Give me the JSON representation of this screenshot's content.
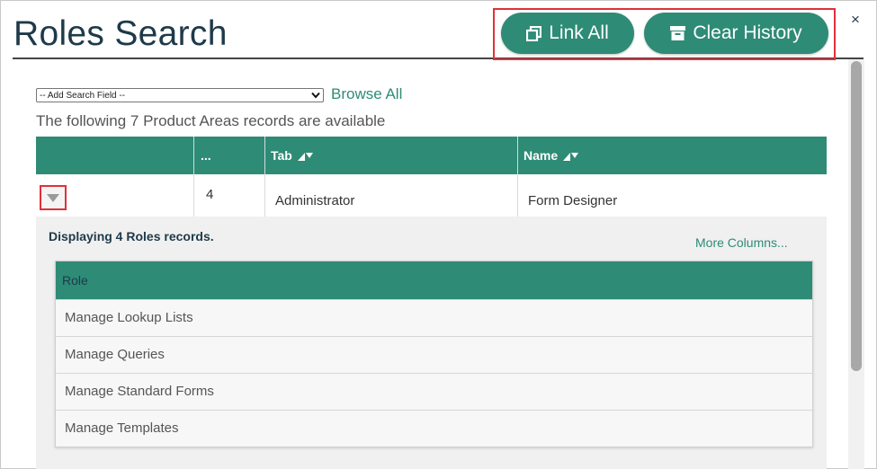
{
  "header": {
    "title": "Roles Search",
    "close_symbol": "×"
  },
  "toolbar": {
    "link_all_label": "Link All",
    "link_all_icon": "link-all-icon",
    "clear_history_label": "Clear History",
    "clear_history_icon": "archive-box-icon"
  },
  "search": {
    "add_field_value": "-- Add Search Field --",
    "browse_all_label": "Browse All",
    "available_text": "The following 7 Product Areas records are available"
  },
  "grid": {
    "columns": [
      {
        "label": ""
      },
      {
        "label": "..."
      },
      {
        "label": "Tab",
        "sort_icon": "sort-icon"
      },
      {
        "label": "Name",
        "sort_icon": "sort-icon"
      }
    ],
    "row": {
      "count": "4",
      "tab": "Administrator",
      "name": "Form Designer"
    }
  },
  "detail": {
    "displaying_text": "Displaying 4 Roles records.",
    "more_columns_label": "More Columns...",
    "column_header": "Role",
    "rows": [
      "Manage Lookup Lists",
      "Manage Queries",
      "Manage Standard Forms",
      "Manage Templates"
    ]
  },
  "colors": {
    "accent": "#2e8b76",
    "title": "#1e3a4a",
    "highlight": "#e0303a"
  }
}
